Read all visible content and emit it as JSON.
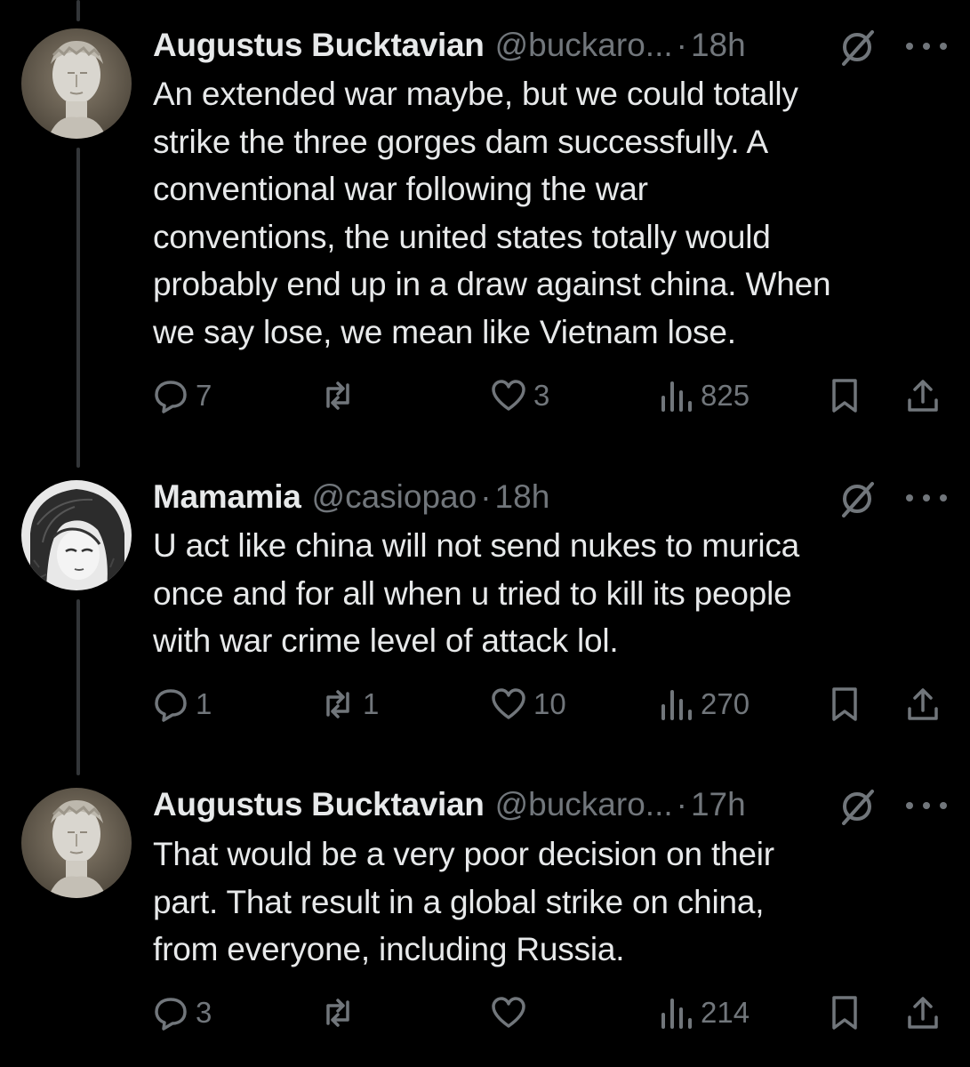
{
  "tweets": [
    {
      "author_name": "Augustus Bucktavian",
      "handle": "@buckaro...",
      "separator": "·",
      "time": "18h",
      "avatar": "statue-avatar",
      "text": "An extended war maybe, but we could totally strike the three gorges dam successfully. A conventional war following the war conventions, the united states totally would probably end up in a draw against china. When we say lose, we mean like Vietnam lose.",
      "lines": [
        "An extended war maybe, but we could totally",
        "strike the three gorges dam successfully. A",
        "conventional war following the war",
        "conventions, the united states totally would",
        "probably end up in a draw against china. When",
        "we say lose, we mean like Vietnam lose."
      ],
      "replies": "7",
      "reposts": "",
      "likes": "3",
      "views": "825"
    },
    {
      "author_name": "Mamamia",
      "handle": "@casiopao",
      "separator": "·",
      "time": "18h",
      "avatar": "anime-sketch-avatar",
      "lines": [
        "U act like china will not send nukes to murica",
        "once and for all when u tried to kill its people",
        "with war crime level of attack lol."
      ],
      "replies": "1",
      "reposts": "1",
      "likes": "10",
      "views": "270"
    },
    {
      "author_name": "Augustus Bucktavian",
      "handle": "@buckaro...",
      "separator": "·",
      "time": "17h",
      "avatar": "statue-avatar",
      "lines": [
        "That would be a very poor decision on their",
        "part. That result in a global strike on china,",
        "from everyone, including Russia."
      ],
      "replies": "3",
      "reposts": "",
      "likes": "",
      "views": "214"
    }
  ],
  "colors": {
    "background": "#000000",
    "text": "#e7e9ea",
    "secondary": "#71767b",
    "thread_line": "#333639"
  },
  "icons": [
    "reply-icon",
    "repost-icon",
    "like-icon",
    "views-icon",
    "bookmark-icon",
    "share-icon",
    "grok-icon",
    "more-icon"
  ]
}
